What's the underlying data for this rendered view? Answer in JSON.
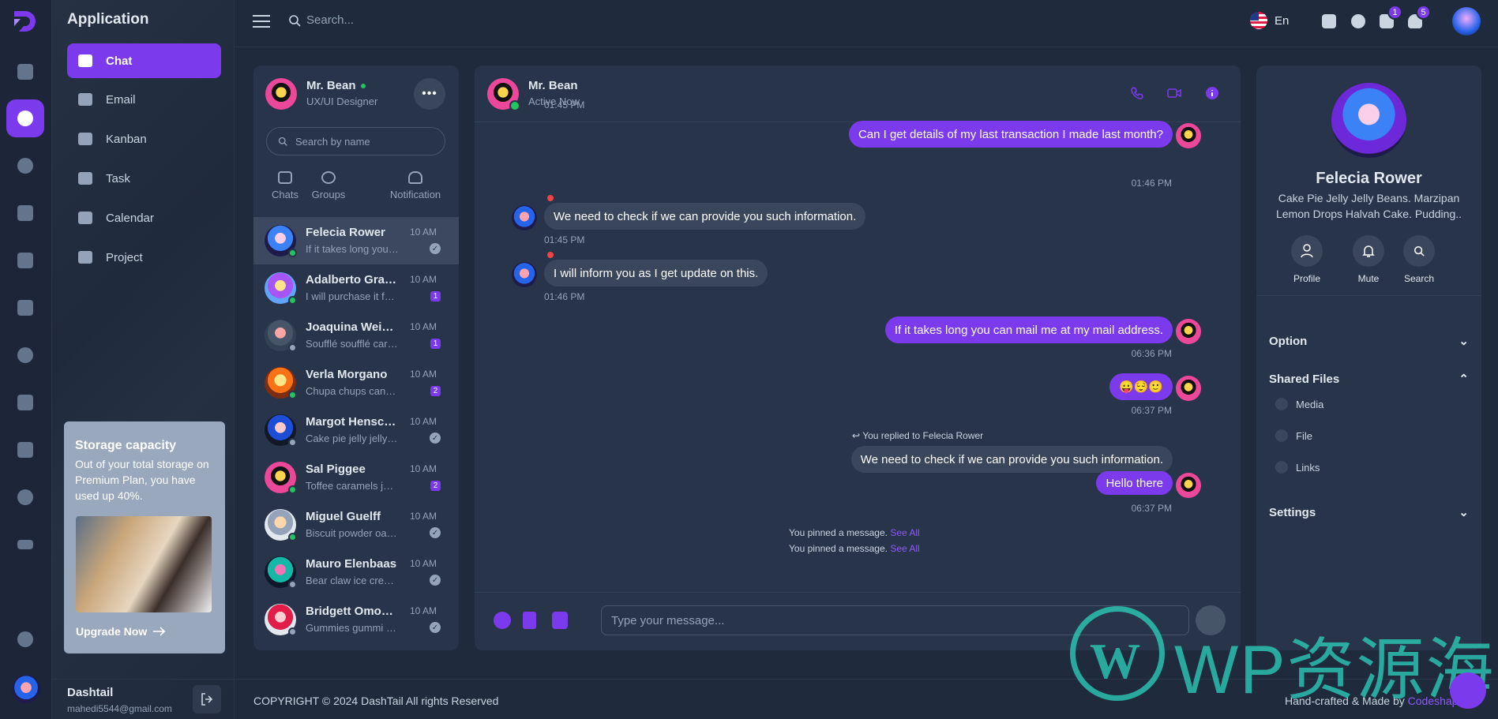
{
  "sidebar": {
    "app_title": "Application",
    "nav": [
      {
        "label": "Chat",
        "active": true
      },
      {
        "label": "Email"
      },
      {
        "label": "Kanban"
      },
      {
        "label": "Task"
      },
      {
        "label": "Calendar"
      },
      {
        "label": "Project"
      }
    ],
    "storage": {
      "title": "Storage capacity",
      "text": "Out of your total storage on Premium Plan, you have used up 40%.",
      "used_fraction": 0.4,
      "cta": "Upgrade Now"
    },
    "user": {
      "name": "Dashtail",
      "email": "mahedi5544@gmail.com"
    }
  },
  "header": {
    "search_placeholder": "Search...",
    "language": "En",
    "mail_badge": "1",
    "notification_badge": "5"
  },
  "chatlist": {
    "me": {
      "name": "Mr. Bean",
      "role": "UX/UI Designer"
    },
    "search_placeholder": "Search by name",
    "tabs": [
      "Chats",
      "Groups",
      "Notification"
    ],
    "contacts": [
      {
        "name": "Felecia Rower",
        "preview": "If it takes long you can mail me",
        "time": "10 AM",
        "status": "read",
        "online": true
      },
      {
        "name": "Adalberto Granzin",
        "preview": "I will purchase it for sure",
        "time": "10 AM",
        "unread": "1",
        "online": true
      },
      {
        "name": "Joaquina Weisenborn",
        "preview": "Soufflé soufflé caramels",
        "time": "10 AM",
        "unread": "1",
        "online": false
      },
      {
        "name": "Verla Morgano",
        "preview": "Chupa chups candy canes",
        "time": "10 AM",
        "unread": "2",
        "online": true
      },
      {
        "name": "Margot Henschke",
        "preview": "Cake pie jelly jelly beans",
        "time": "10 AM",
        "status": "read",
        "online": false
      },
      {
        "name": "Sal Piggee",
        "preview": "Toffee caramels jelly-o",
        "time": "10 AM",
        "unread": "2",
        "online": true
      },
      {
        "name": "Miguel Guelff",
        "preview": "Biscuit powder oat cake",
        "time": "10 AM",
        "status": "read",
        "online": true
      },
      {
        "name": "Mauro Elenbaas",
        "preview": "Bear claw ice cream lollipop",
        "time": "10 AM",
        "status": "read",
        "online": false
      },
      {
        "name": "Bridgett Omohundro",
        "preview": "Gummies gummi bears",
        "time": "10 AM",
        "status": "read",
        "online": false
      }
    ]
  },
  "conversation": {
    "contact_name": "Mr. Bean",
    "contact_status": "Active Now",
    "messages": [
      {
        "time": "01:45 PM"
      },
      {
        "text": "Can I get details of my last transaction I made last month?",
        "time": "01:46 PM",
        "dir": "out"
      },
      {
        "text": "We need to check if we can provide you such information.",
        "time": "01:45 PM",
        "dir": "in"
      },
      {
        "text": "I will inform you as I get update on this.",
        "time": "01:46 PM",
        "dir": "in"
      },
      {
        "text": "If it takes long you can mail me at my mail address.",
        "time": "06:36 PM",
        "dir": "out"
      },
      {
        "text": "😛😌🙂",
        "time": "06:37 PM",
        "dir": "out"
      },
      {
        "reply_prefix": "You replied to",
        "reply_to": "Felecia Rower",
        "text": "We need to check if we can provide you such information.",
        "dir": "out-quoted"
      },
      {
        "text": "Hello there",
        "time": "06:37 PM",
        "dir": "out"
      }
    ],
    "pinned": [
      {
        "text": "You pinned a message.",
        "link": "See All"
      },
      {
        "text": "You pinned a message.",
        "link": "See All"
      }
    ],
    "composer_placeholder": "Type your message..."
  },
  "profile": {
    "name": "Felecia Rower",
    "bio": "Cake Pie Jelly Jelly Beans. Marzipan Lemon Drops Halvah Cake. Pudding..",
    "actions": [
      "Profile",
      "Mute",
      "Search"
    ],
    "sections": {
      "option": "Option",
      "shared_files": "Shared Files",
      "settings": "Settings"
    },
    "files": [
      "Media",
      "File",
      "Links"
    ]
  },
  "footer": {
    "copyright": "COPYRIGHT © 2024 DashTail All rights Reserved",
    "made_by_prefix": "Hand-crafted & Made by",
    "made_by_brand": "Codeshaper"
  },
  "watermark": {
    "logo_letter": "W",
    "text": "WP资源海"
  },
  "colors": {
    "accent": "#7c3aed",
    "bg": "#1f2a3c",
    "panel": "#28344a",
    "online": "#22c55e"
  }
}
